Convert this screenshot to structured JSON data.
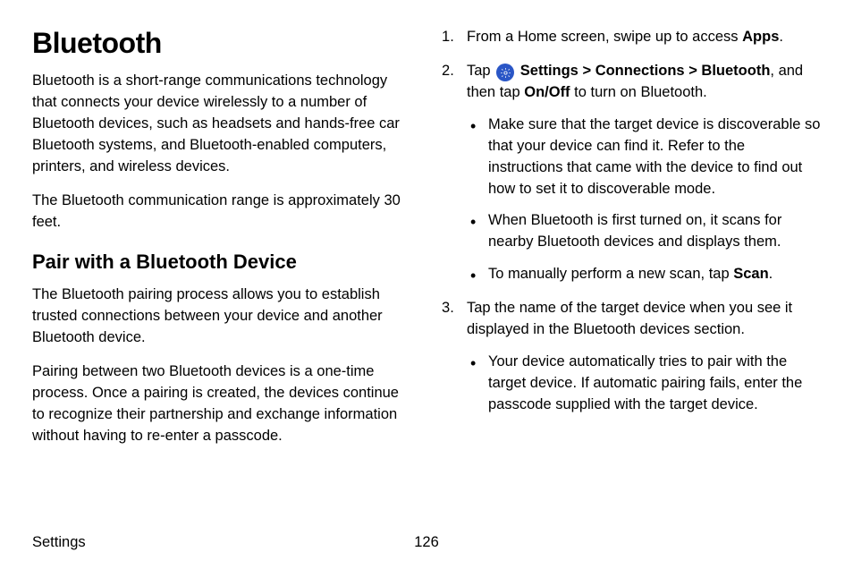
{
  "left": {
    "h1": "Bluetooth",
    "p1": "Bluetooth is a short-range communications technology that connects your device wirelessly to a number of Bluetooth devices, such as headsets and hands-free car Bluetooth systems, and Bluetooth-enabled computers, printers, and wireless devices.",
    "p2": "The Bluetooth communication range is approximately 30 feet.",
    "h2": "Pair with a Bluetooth Device",
    "p3": "The Bluetooth pairing process allows you to establish trusted connections between your device and another Bluetooth device.",
    "p4": "Pairing between two Bluetooth devices is a one-time process. Once a pairing is created, the devices continue to recognize their partnership and exchange information without having to re-enter a passcode."
  },
  "right": {
    "step1_prefix": "From a Home screen, swipe up to access ",
    "step1_bold": "Apps",
    "step1_suffix": ".",
    "step2_a": "Tap ",
    "step2_settings": " Settings",
    "step2_sep1": " > ",
    "step2_conn": "Connections",
    "step2_sep2": " > ",
    "step2_bt": "Bluetooth",
    "step2_b": ", and then tap ",
    "step2_onoff": "On/Off",
    "step2_c": " to turn on Bluetooth.",
    "step2_bullets": {
      "b1": "Make sure that the target device is discoverable so that your device can find it. Refer to the instructions that came with the device to find out how to set it to discoverable mode.",
      "b2": "When Bluetooth is first turned on, it scans for nearby Bluetooth devices and displays them.",
      "b3_prefix": "To manually perform a new scan, tap ",
      "b3_bold": "Scan",
      "b3_suffix": "."
    },
    "step3": "Tap the name of the target device when you see it displayed in the Bluetooth devices section.",
    "step3_bullets": {
      "b1": "Your device automatically tries to pair with the target device. If automatic pairing fails, enter the passcode supplied with the target device."
    }
  },
  "footer": {
    "section": "Settings",
    "page": "126"
  }
}
